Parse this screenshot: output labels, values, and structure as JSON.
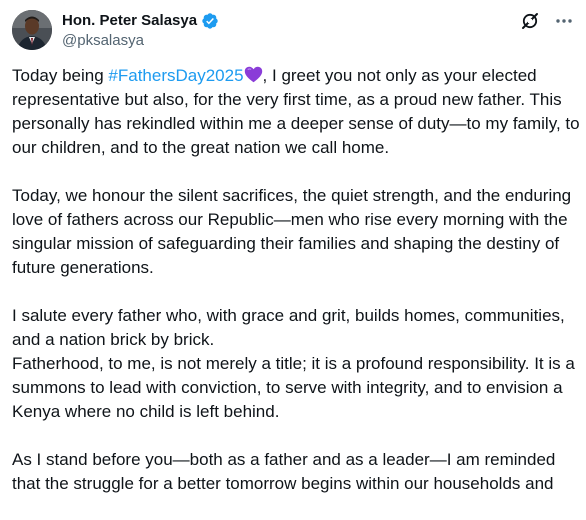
{
  "author": {
    "display_name": "Hon. Peter Salasya",
    "handle": "@pksalasya",
    "verified": true
  },
  "icons": {
    "avatar": "profile-photo",
    "verified": "verified-badge-icon",
    "grok": "grok-icon",
    "more": "more-options-icon",
    "emoji": "purple-heart-emoji"
  },
  "colors": {
    "text": "#0f1419",
    "secondary": "#536471",
    "link": "#1d9bf0",
    "verified": "#1d9bf0",
    "heart": "#8a3cd8"
  },
  "tweet": {
    "p1_before_tag": "Today being ",
    "hashtag": "#FathersDay2025",
    "p1_after_tag": ", I greet you not only as your elected representative but also, for the very first time, as a proud new father. This personally has rekindled within me a deeper sense of duty—to my family, to our children, and to the great nation we call home.",
    "p2": "Today, we honour the silent sacrifices, the quiet strength, and the enduring love of fathers across our Republic—men who rise every morning with the singular mission of safeguarding their families and shaping the destiny of future generations.",
    "p3a": "I salute every father who, with grace and grit, builds homes, communities, and a nation brick by brick.",
    "p3b": "Fatherhood, to me, is not merely a title; it is a profound responsibility. It is a summons to lead with conviction, to serve with integrity, and to envision a Kenya where no child is left behind.",
    "p4": "As I stand before you—both as a father and as a leader—I am reminded that the struggle for a better tomorrow begins within our households and"
  }
}
